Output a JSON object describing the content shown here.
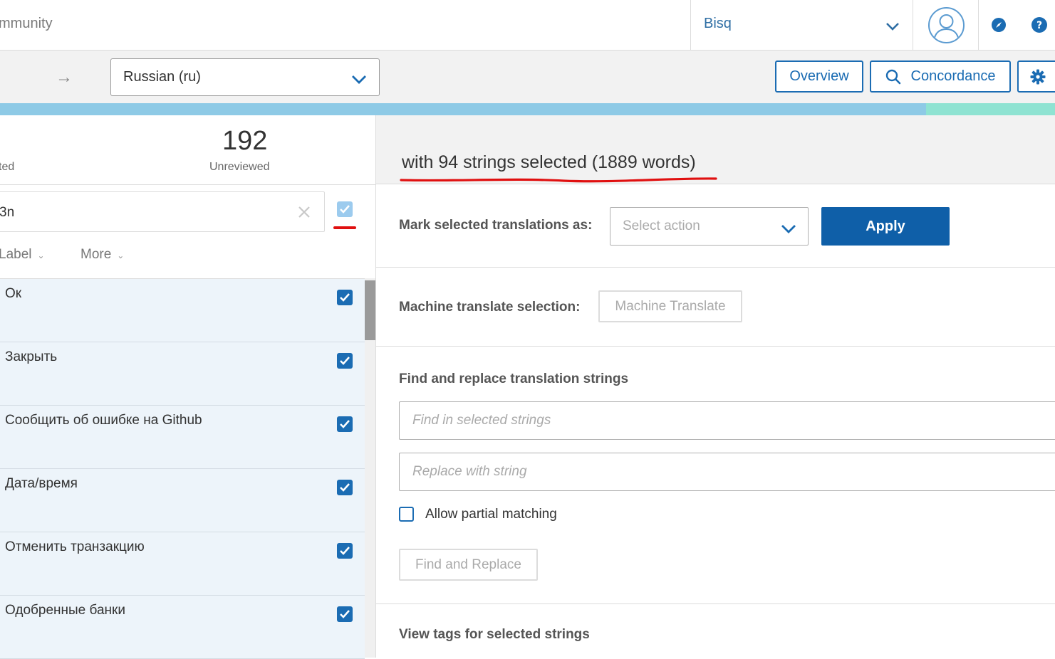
{
  "topbar": {
    "community_text": "mmunity",
    "project_name": "Bisq",
    "icons": [
      "chevron-down-icon",
      "user-avatar-icon",
      "compass-icon",
      "help-icon"
    ]
  },
  "toolbar": {
    "arrow": "→",
    "language_select": "Russian (ru)",
    "overview_label": "Overview",
    "concordance_label": "Concordance"
  },
  "progress": {
    "primary_color": "#8ecae6",
    "secondary_color": "#8fe3d2",
    "primary_fraction": 0.878
  },
  "stats": {
    "partial_label": "ted",
    "unreviewed_count": "192",
    "unreviewed_label": "Unreviewed"
  },
  "search": {
    "value": "3n"
  },
  "filters": {
    "label": "Label",
    "more": "More"
  },
  "strings": [
    {
      "text": "Ок",
      "checked": true
    },
    {
      "text": "Закрыть",
      "checked": true
    },
    {
      "text": "Сообщить об ошибке на Github",
      "checked": true
    },
    {
      "text": "Дата/время",
      "checked": true
    },
    {
      "text": "Отменить транзакцию",
      "checked": true
    },
    {
      "text": "Одобренные банки",
      "checked": true
    }
  ],
  "bulk": {
    "summary": "with 94 strings selected (1889 words)",
    "mark_label": "Mark selected translations as:",
    "select_placeholder": "Select action",
    "apply_label": "Apply",
    "mt_label": "Machine translate selection:",
    "mt_button": "Machine Translate",
    "fr_title": "Find and replace translation strings",
    "find_placeholder": "Find in selected strings",
    "replace_placeholder": "Replace with string",
    "partial_label": "Allow partial matching",
    "fr_button": "Find and Replace",
    "tags_title": "View tags for selected strings"
  },
  "colors": {
    "accent": "#1b6cb3",
    "apply_bg": "#0f5fa8",
    "row_bg": "#edf4fa",
    "annotation_red": "#e01010"
  }
}
